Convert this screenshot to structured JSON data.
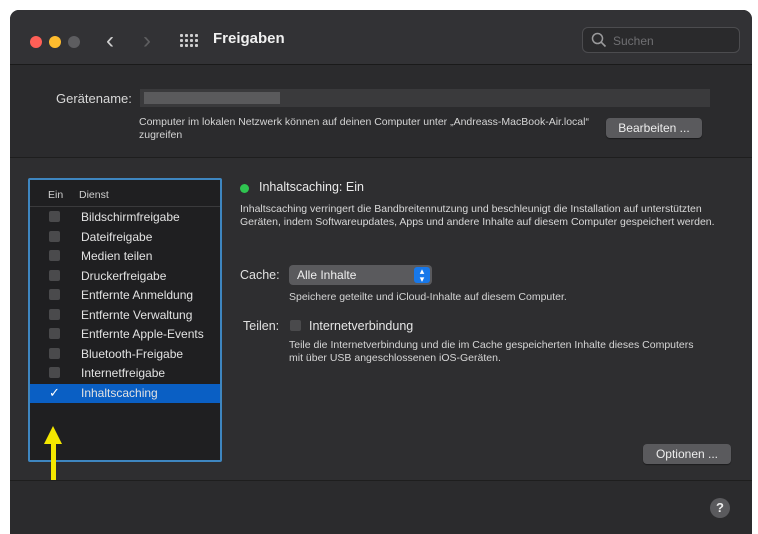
{
  "window": {
    "title": "Freigaben",
    "search": {
      "placeholder": "Suchen"
    }
  },
  "computer_name": {
    "label": "Gerätename:",
    "value": "",
    "description": "Computer im lokalen Netzwerk können auf deinen Computer unter „Andreass-MacBook-Air.local“ zugreifen",
    "edit_button": "Bearbeiten ..."
  },
  "services": {
    "header_on": "Ein",
    "header_service": "Dienst",
    "items": [
      {
        "label": "Bildschirmfreigabe",
        "checked": false
      },
      {
        "label": "Dateifreigabe",
        "checked": false
      },
      {
        "label": "Medien teilen",
        "checked": false
      },
      {
        "label": "Druckerfreigabe",
        "checked": false
      },
      {
        "label": "Entfernte Anmeldung",
        "checked": false
      },
      {
        "label": "Entfernte Verwaltung",
        "checked": false
      },
      {
        "label": "Entfernte Apple-Events",
        "checked": false
      },
      {
        "label": "Bluetooth-Freigabe",
        "checked": false
      },
      {
        "label": "Internetfreigabe",
        "checked": false
      },
      {
        "label": "Inhaltscaching",
        "checked": true,
        "checkmark": "✓"
      }
    ]
  },
  "detail": {
    "status": "Inhaltscaching: Ein",
    "status_color": "#2fc450",
    "description": "Inhaltscaching verringert die Bandbreitennutzung und beschleunigt die Installation auf unterstützten Geräten, indem Softwareupdates, Apps und andere Inhalte auf diesem Computer gespeichert werden.",
    "cache_label": "Cache:",
    "cache_value": "Alle Inhalte",
    "cache_description": "Speichere geteilte und iCloud-Inhalte auf diesem Computer.",
    "share_label": "Teilen:",
    "share_checkbox_label": "Internetverbindung",
    "share_description": "Teile die Internetverbindung und die im Cache gespeicherten Inhalte dieses Computers mit über USB angeschlossenen iOS-Geräten.",
    "options_button": "Optionen ...",
    "help": "?"
  },
  "colors": {
    "accent": "#0a5fc4",
    "annotation_arrow": "#f4e700",
    "panel_border": "#3e86c0"
  }
}
